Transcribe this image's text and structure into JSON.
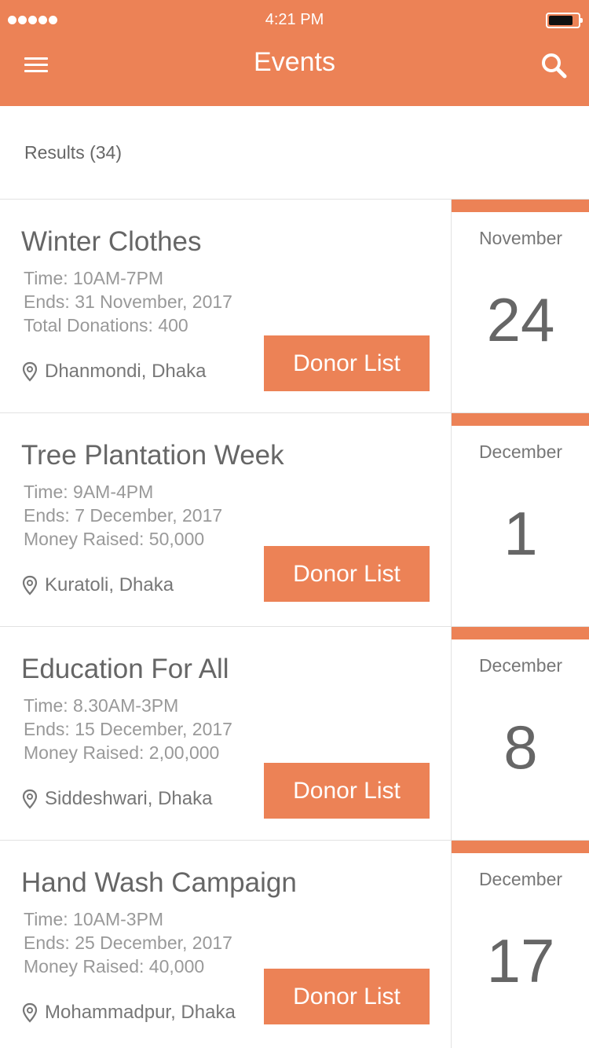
{
  "status_bar": {
    "time": "4:21 PM"
  },
  "header": {
    "title": "Events",
    "menu_icon": "hamburger-menu-icon",
    "search_icon": "search-icon"
  },
  "results_label": "Results (34)",
  "colors": {
    "accent": "#ec8256",
    "text": "#666666",
    "muted": "#999999",
    "divider": "#e2e2e2"
  },
  "events": [
    {
      "title": "Winter Clothes",
      "time": "Time: 10AM-7PM",
      "ends": "Ends: 31 November, 2017",
      "stat": "Total Donations: 400",
      "location": "Dhanmondi, Dhaka",
      "button": "Donor List",
      "month": "November",
      "day": "24"
    },
    {
      "title": "Tree Plantation Week",
      "time": "Time: 9AM-4PM",
      "ends": "Ends: 7 December, 2017",
      "stat": "Money Raised: 50,000",
      "location": "Kuratoli, Dhaka",
      "button": "Donor List",
      "month": "December",
      "day": "1"
    },
    {
      "title": "Education For All",
      "time": "Time: 8.30AM-3PM",
      "ends": "Ends: 15 December, 2017",
      "stat": "Money Raised: 2,00,000",
      "location": "Siddeshwari, Dhaka",
      "button": "Donor List",
      "month": "December",
      "day": "8"
    },
    {
      "title": "Hand Wash Campaign",
      "time": "Time: 10AM-3PM",
      "ends": "Ends: 25 December, 2017",
      "stat": "Money Raised: 40,000",
      "location": "Mohammadpur, Dhaka",
      "button": "Donor List",
      "month": "December",
      "day": "17"
    }
  ]
}
